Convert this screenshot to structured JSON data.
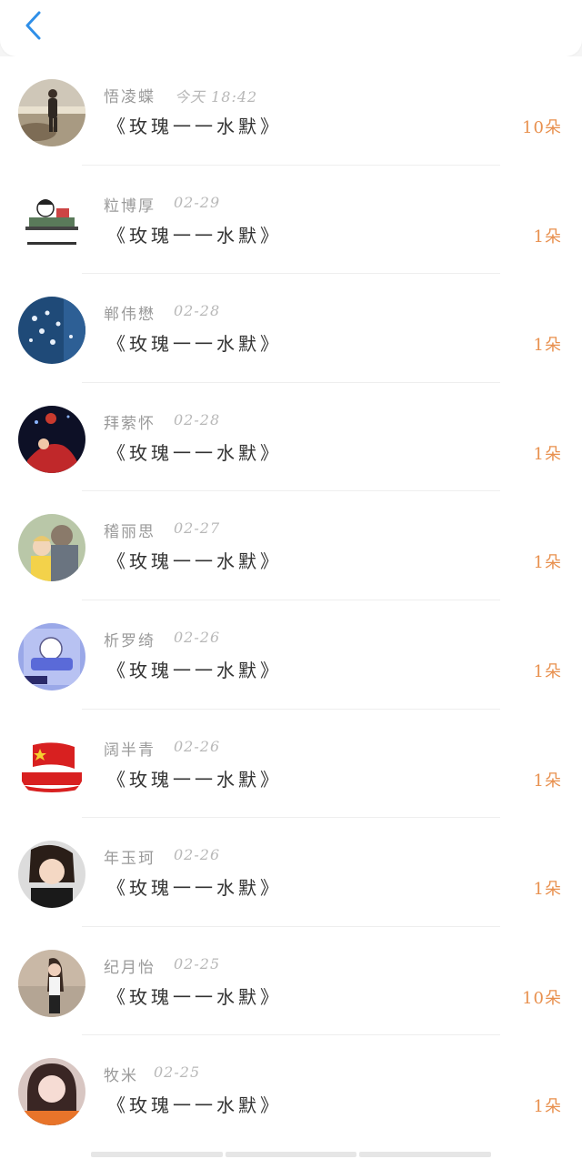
{
  "header": {
    "back_icon": "chevron-left-icon",
    "accent": "#2f8fe8"
  },
  "gift_list": [
    {
      "name": "悟凌蝶",
      "date": "今天 18:42",
      "gift": "《玫瑰一一水默》",
      "count": "10朵",
      "avatar": "person-on-rocks"
    },
    {
      "name": "粒博厚",
      "date": "02-29",
      "gift": "《玫瑰一一水默》",
      "count": "1朵",
      "avatar": "cartoon-desk"
    },
    {
      "name": "郸伟懋",
      "date": "02-28",
      "gift": "《玫瑰一一水默》",
      "count": "1朵",
      "avatar": "blue-birds"
    },
    {
      "name": "拜萦怀",
      "date": "02-28",
      "gift": "《玫瑰一一水默》",
      "count": "1朵",
      "avatar": "dancer-red"
    },
    {
      "name": "稽丽思",
      "date": "02-27",
      "gift": "《玫瑰一一水默》",
      "count": "1朵",
      "avatar": "man-and-child"
    },
    {
      "name": "析罗绮",
      "date": "02-26",
      "gift": "《玫瑰一一水默》",
      "count": "1朵",
      "avatar": "cartoon-bed"
    },
    {
      "name": "阔半青",
      "date": "02-26",
      "gift": "《玫瑰一一水默》",
      "count": "1朵",
      "avatar": "flag-island"
    },
    {
      "name": "年玉珂",
      "date": "02-26",
      "gift": "《玫瑰一一水默》",
      "count": "1朵",
      "avatar": "child-photo"
    },
    {
      "name": "纪月怡",
      "date": "02-25",
      "gift": "《玫瑰一一水默》",
      "count": "10朵",
      "avatar": "girl-street"
    },
    {
      "name": "牧米",
      "date": "02-25",
      "gift": "《玫瑰一一水默》",
      "count": "1朵",
      "avatar": "girl-portrait"
    }
  ],
  "colors": {
    "count": "#e8904e",
    "name": "#9a9a9a",
    "date": "#b8b8b8",
    "gift": "#333333"
  }
}
